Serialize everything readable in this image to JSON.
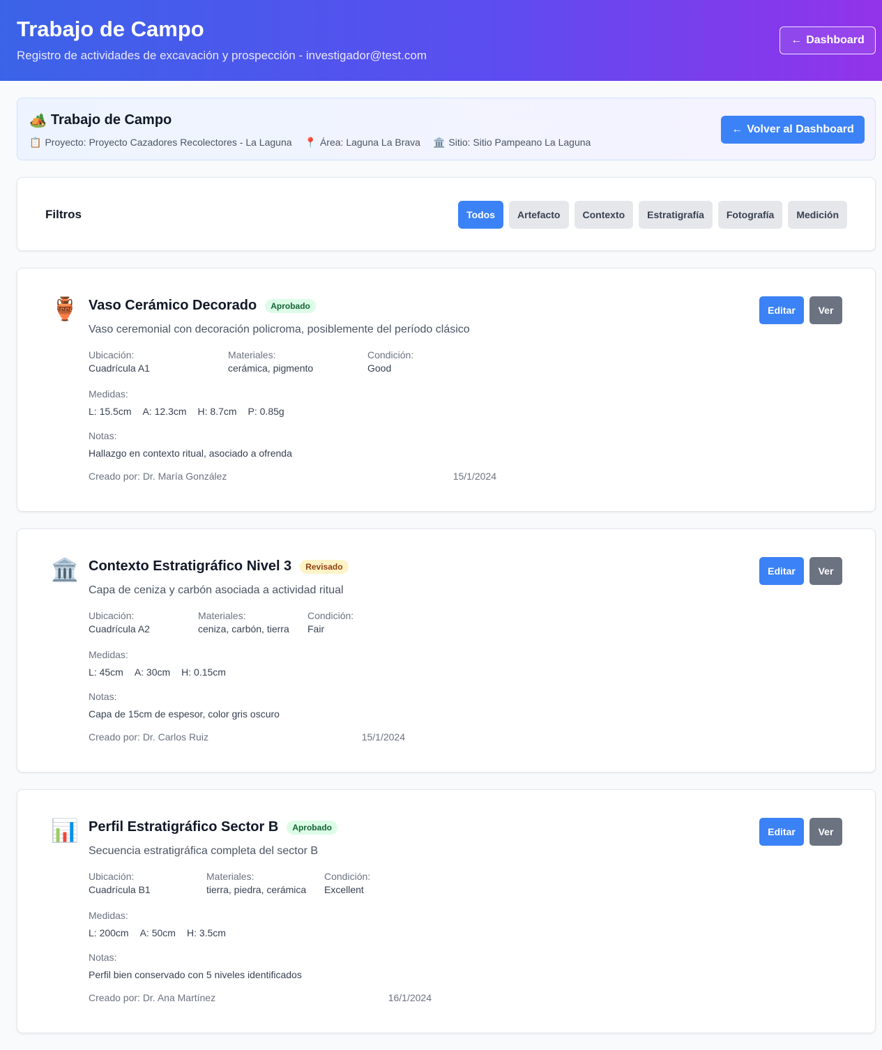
{
  "header": {
    "title": "Trabajo de Campo",
    "subtitle": "Registro de actividades de excavación y prospección - investigador@test.com",
    "dashboard_button": "Dashboard",
    "arrow": "←"
  },
  "info": {
    "icon": "🏕️",
    "title": "Trabajo de Campo",
    "project_icon": "📋",
    "project": "Proyecto: Proyecto Cazadores Recolectores - La Laguna",
    "area_icon": "📍",
    "area": "Área: Laguna La Brava",
    "site_icon": "🏛️",
    "site": "Sitio: Sitio Pampeano La Laguna",
    "back_button": "Volver al Dashboard"
  },
  "filters": {
    "title": "Filtros",
    "options": [
      "Todos",
      "Artefacto",
      "Contexto",
      "Estratigrafía",
      "Fotografía",
      "Medición"
    ],
    "active": "Todos"
  },
  "labels": {
    "location": "Ubicación:",
    "materials": "Materiales:",
    "condition": "Condición:",
    "measures": "Medidas:",
    "notes": "Notas:",
    "edit": "Editar",
    "view": "Ver"
  },
  "records": [
    {
      "icon": "🏺",
      "title": "Vaso Cerámico Decorado",
      "status": "Aprobado",
      "status_type": "aprobado",
      "description": "Vaso ceremonial con decoración policroma, posiblemente del período clásico",
      "location": "Cuadrícula A1",
      "materials": "cerámica, pigmento",
      "condition": "Good",
      "measures": [
        "L: 15.5cm",
        "A: 12.3cm",
        "H: 8.7cm",
        "P: 0.85g"
      ],
      "notes": "Hallazgo en contexto ritual, asociado a ofrenda",
      "created_by": "Creado por: Dr. María González",
      "date": "15/1/2024"
    },
    {
      "icon": "🏛️",
      "title": "Contexto Estratigráfico Nivel 3",
      "status": "Revisado",
      "status_type": "revisado",
      "description": "Capa de ceniza y carbón asociada a actividad ritual",
      "location": "Cuadrícula A2",
      "materials": "ceniza, carbón, tierra",
      "condition": "Fair",
      "measures": [
        "L: 45cm",
        "A: 30cm",
        "H: 0.15cm"
      ],
      "notes": "Capa de 15cm de espesor, color gris oscuro",
      "created_by": "Creado por: Dr. Carlos Ruiz",
      "date": "15/1/2024"
    },
    {
      "icon": "📊",
      "title": "Perfil Estratigráfico Sector B",
      "status": "Aprobado",
      "status_type": "aprobado",
      "description": "Secuencia estratigráfica completa del sector B",
      "location": "Cuadrícula B1",
      "materials": "tierra, piedra, cerámica",
      "condition": "Excellent",
      "measures": [
        "L: 200cm",
        "A: 50cm",
        "H: 3.5cm"
      ],
      "notes": "Perfil bien conservado con 5 niveles identificados",
      "created_by": "Creado por: Dr. Ana Martínez",
      "date": "16/1/2024"
    }
  ]
}
